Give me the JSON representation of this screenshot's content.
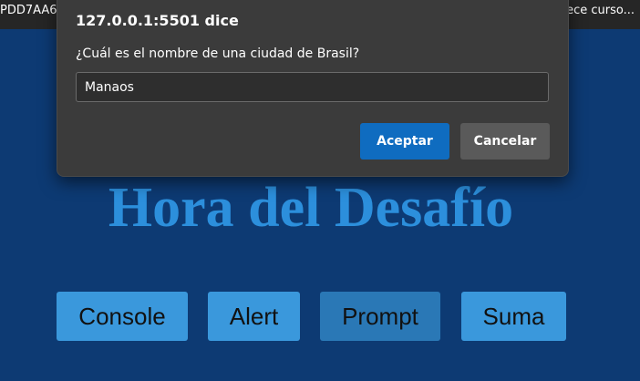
{
  "browser": {
    "tab_left_text": "PDD7AA6",
    "tab_right_text": "ece curso..."
  },
  "page": {
    "title": "Hora del Desafío",
    "buttons": {
      "console": "Console",
      "alert": "Alert",
      "prompt": "Prompt",
      "suma": "Suma"
    }
  },
  "dialog": {
    "origin": "127.0.0.1:5501 dice",
    "message": "¿Cuál es el nombre de una ciudad de Brasil?",
    "input_value": "Manaos",
    "ok_label": "Aceptar",
    "cancel_label": "Cancelar"
  },
  "colors": {
    "page_background": "#0d3a73",
    "title": "#2c8fdc",
    "button": "#3a98dc",
    "button_active": "#2a78b6",
    "dialog_background": "#3b3b3b",
    "dialog_ok": "#0f6cc0",
    "dialog_cancel": "#5a5a5a"
  }
}
